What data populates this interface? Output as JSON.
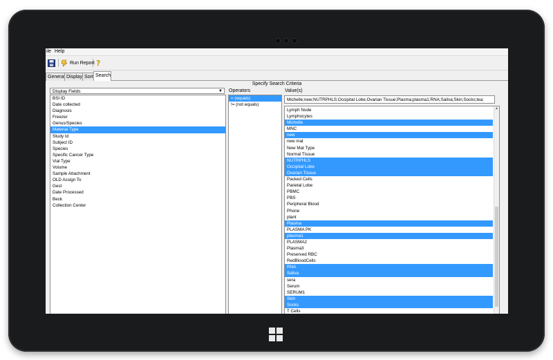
{
  "menu": {
    "file": "ile",
    "help": "Help"
  },
  "toolbar": {
    "run_report_label": "Run Report"
  },
  "tabs": [
    {
      "label": "General"
    },
    {
      "label": "Display"
    },
    {
      "label": "Sort"
    },
    {
      "label": "Search"
    }
  ],
  "active_tab": "Search",
  "criteria_title": "Specify Search Criteria",
  "display_fields": {
    "header": "Display Fields",
    "items": [
      "BSI ID",
      "Date collected",
      "Diagnosis",
      "Freezer",
      "Genus/Species",
      "Material Type",
      "Study Id",
      "Subject ID",
      "Species",
      "Specific Cancer Type",
      "Vial Type",
      "Volume",
      "Sample Attachment",
      "OLD Assign To",
      "Gest",
      "Date Processed",
      "Beck",
      "Collection Center"
    ],
    "selected": "Material Type"
  },
  "operators": {
    "header": "Operators",
    "items": [
      "= (equals)",
      "!= (not equals)"
    ],
    "selected": "= (equals)"
  },
  "values": {
    "header": "Value(s)",
    "input_value": "Michelle;new;NUTRPHLS;Occipital Lobe;Ovarian Tissue;Plasma;plasma1;RNA;Saliva;Skin;Socks;tea;",
    "items": [
      {
        "label": "Lymph Node",
        "selected": false
      },
      {
        "label": "Lymphocytes",
        "selected": false
      },
      {
        "label": "Michelle",
        "selected": true
      },
      {
        "label": "MNC",
        "selected": false
      },
      {
        "label": "new",
        "selected": true
      },
      {
        "label": "new mat",
        "selected": false
      },
      {
        "label": "New Mat Type",
        "selected": false
      },
      {
        "label": "Normal Tissue",
        "selected": false
      },
      {
        "label": "NUTRPHLS",
        "selected": true
      },
      {
        "label": "Occipital Lobe",
        "selected": true
      },
      {
        "label": "Ovarian Tissue",
        "selected": true
      },
      {
        "label": "Packed Cells",
        "selected": false
      },
      {
        "label": "Parietal Lobe",
        "selected": false
      },
      {
        "label": "PBMC",
        "selected": false
      },
      {
        "label": "PBS",
        "selected": false
      },
      {
        "label": "Peripheral Blood",
        "selected": false
      },
      {
        "label": "Phone",
        "selected": false
      },
      {
        "label": "plant",
        "selected": false
      },
      {
        "label": "Plasma",
        "selected": true
      },
      {
        "label": "PLASMA PK",
        "selected": false
      },
      {
        "label": "plasma1",
        "selected": true
      },
      {
        "label": "PLASMA2",
        "selected": false
      },
      {
        "label": "Plasma3",
        "selected": false
      },
      {
        "label": "Preserved RBC",
        "selected": false
      },
      {
        "label": "RedBloodCells",
        "selected": false
      },
      {
        "label": "RNA",
        "selected": true
      },
      {
        "label": "Saliva",
        "selected": true
      },
      {
        "label": "sera",
        "selected": false
      },
      {
        "label": "Serum",
        "selected": false
      },
      {
        "label": "SERUM1",
        "selected": false
      },
      {
        "label": "Skin",
        "selected": true
      },
      {
        "label": "Socks",
        "selected": true
      },
      {
        "label": "T Cells",
        "selected": false
      }
    ]
  },
  "colors": {
    "selection": "#3399ff",
    "bezel": "#1a1b1d"
  }
}
